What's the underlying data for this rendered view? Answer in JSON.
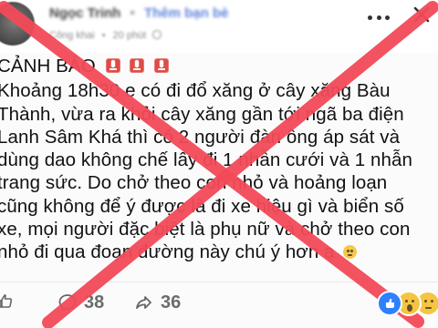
{
  "post": {
    "author": "Ngọc Trinh",
    "separator": "•",
    "add_friend": "Thêm bạn bè",
    "meta_audience": "Công khai",
    "meta_time": "20 phút",
    "title": "CẢNH BÁO",
    "lines": [
      "Khoảng 18h30 e có đi đổ xăng ở cây xăng Bàu",
      "Thành, vừa ra khỏi cây xăng gần tới ngã ba điện",
      "Lanh Sâm Khá thì có 2 người đàn ông áp sát và",
      "dùng dao không chế lấy đi 1 nhẫn cưới và 1 nhẫn",
      "trang sức. Do chở theo con nhỏ và hoảng loạn",
      "cũng không để ý được là đi xe hiệu gì và biển số",
      "xe, mọi người đặc biệt là phụ nữ và chở theo con",
      "nhỏ đi qua đoạn đường này chú ý hơn ạ"
    ]
  },
  "actions": {
    "comment_count": "38",
    "share_count": "36"
  },
  "icons": {
    "more": "more-options-icon",
    "close": "close-icon",
    "siren": "siren-icon",
    "emoji": "pleading-face-icon",
    "like": "like-icon",
    "comment": "comment-icon",
    "share": "share-icon",
    "reaction_like": "like-reaction-icon",
    "reaction_wow": "wow-reaction-icon",
    "reaction_sad": "sad-reaction-icon"
  },
  "colors": {
    "warning_cross": "#f34a58",
    "brand_blue": "#2f80ff",
    "text_primary": "#111111",
    "text_muted": "#6b6b6b"
  }
}
